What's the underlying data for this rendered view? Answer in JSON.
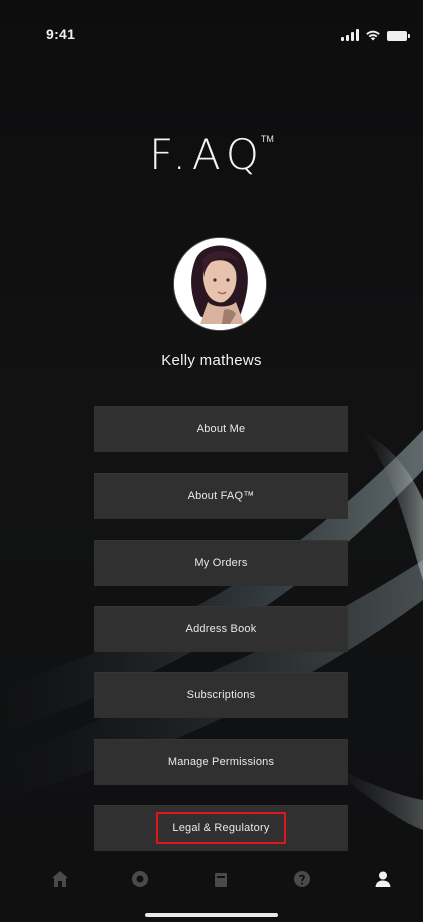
{
  "status_bar": {
    "time": "9:41",
    "icons": [
      "signal-icon",
      "wifi-icon",
      "battery-icon"
    ]
  },
  "brand": {
    "logo_text": "F.AQ",
    "trademark": "TM"
  },
  "profile": {
    "name": "Kelly mathews",
    "avatar": "avatar-photo"
  },
  "menu": {
    "items": [
      {
        "label": "About Me"
      },
      {
        "label": "About FAQ™"
      },
      {
        "label": "My Orders"
      },
      {
        "label": "Address Book"
      },
      {
        "label": "Subscriptions"
      },
      {
        "label": "Manage Permissions"
      },
      {
        "label": "Legal & Regulatory",
        "highlighted": true
      }
    ]
  },
  "tab_bar": {
    "tabs": [
      {
        "icon": "home-icon",
        "active": false
      },
      {
        "icon": "explore-icon",
        "active": false
      },
      {
        "icon": "bag-icon",
        "active": false
      },
      {
        "icon": "help-icon",
        "active": false
      },
      {
        "icon": "profile-icon",
        "active": true
      }
    ]
  },
  "colors": {
    "background": "#0d0d0e",
    "button": "#303031",
    "highlight": "#e0161b",
    "text": "#f1f1f1"
  }
}
